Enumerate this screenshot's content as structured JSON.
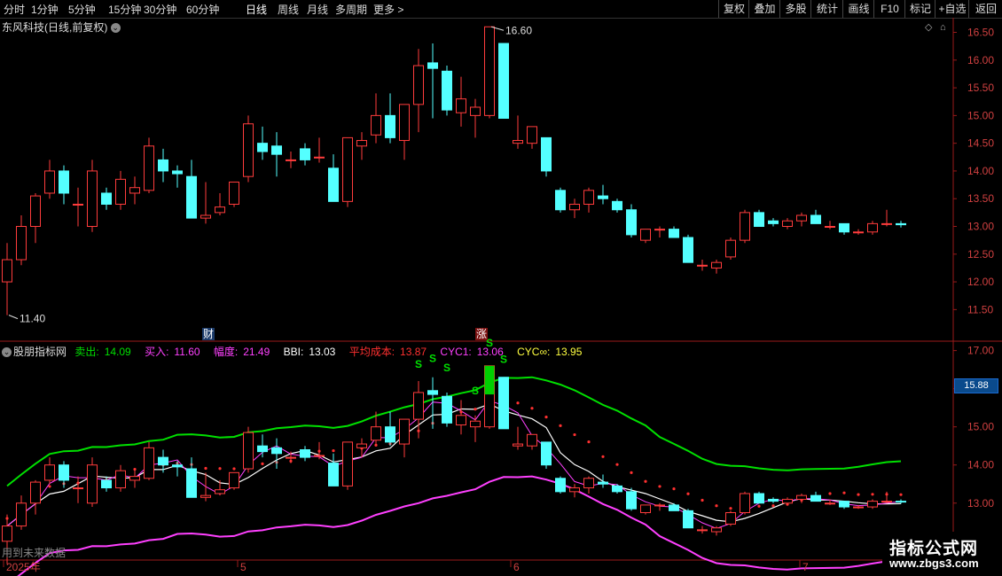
{
  "toolbar": {
    "periods": [
      "分时",
      "1分钟",
      "5分钟",
      "15分钟",
      "30分钟",
      "60分钟",
      "日线",
      "周线",
      "月线",
      "多周期",
      "更多 >"
    ],
    "active_period": "日线",
    "right_buttons": [
      "复权",
      "叠加",
      "多股",
      "统计",
      "画线",
      "F10",
      "标记",
      "+自选",
      "返回"
    ]
  },
  "stock": {
    "title": "东风科技(日线,前复权)",
    "high_label": "16.60",
    "low_label": "11.40",
    "badge_cai": "财",
    "badge_zhang": "涨"
  },
  "main_axis": {
    "ticks": [
      "16.50",
      "16.00",
      "15.50",
      "15.00",
      "14.50",
      "14.00",
      "13.50",
      "13.00",
      "12.50",
      "12.00",
      "11.50"
    ]
  },
  "indicator": {
    "name": "股朋指标网",
    "sell": {
      "label": "卖出:",
      "value": "14.09"
    },
    "buy": {
      "label": "买入:",
      "value": "11.60"
    },
    "range": {
      "label": "幅度:",
      "value": "21.49"
    },
    "bbi": {
      "label": "BBI:",
      "value": "13.03"
    },
    "avg_cost": {
      "label": "平均成本:",
      "value": "13.87"
    },
    "cyc1": {
      "label": "CYC1:",
      "value": "13.06"
    },
    "cycinf": {
      "label": "CYC∞:",
      "value": "13.95"
    },
    "current_price": "15.88",
    "signal_letter": "S",
    "future_note": "用到未来数据",
    "axis_ticks": [
      "17.00",
      "16.00",
      "15.00",
      "14.00",
      "13.00",
      "12.00"
    ]
  },
  "date_axis": {
    "labels": [
      "2025年",
      "5",
      "6",
      "7"
    ]
  },
  "watermark": {
    "title": "指标公式网",
    "url": "www.zbgs3.com"
  },
  "colors": {
    "up": "#ff3c3c",
    "down": "#54ffff",
    "sell": "#00e000",
    "buy": "#ff40ff",
    "bbi": "#ffffff",
    "avg_cost": "#ff3030",
    "cyc1": "#ff40ff",
    "cycinf": "#ffff40"
  },
  "chart_data": {
    "type": "candlestick",
    "series_name": "东风科技",
    "ohlc": [
      [
        12.0,
        12.7,
        11.4,
        12.4
      ],
      [
        12.4,
        13.2,
        12.3,
        13.0
      ],
      [
        13.0,
        13.6,
        12.7,
        13.55
      ],
      [
        13.6,
        14.2,
        13.5,
        14.0
      ],
      [
        14.0,
        14.1,
        13.4,
        13.6
      ],
      [
        13.4,
        13.7,
        13.0,
        13.4
      ],
      [
        13.0,
        14.2,
        12.9,
        14.0
      ],
      [
        13.6,
        13.7,
        13.3,
        13.4
      ],
      [
        13.4,
        14.0,
        13.3,
        13.85
      ],
      [
        13.6,
        13.9,
        13.4,
        13.7
      ],
      [
        13.65,
        14.6,
        13.6,
        14.45
      ],
      [
        14.2,
        14.4,
        13.8,
        14.0
      ],
      [
        14.0,
        14.1,
        13.7,
        13.95
      ],
      [
        13.9,
        14.2,
        13.15,
        13.15
      ],
      [
        13.15,
        13.8,
        13.05,
        13.2
      ],
      [
        13.25,
        13.6,
        13.2,
        13.35
      ],
      [
        13.4,
        13.8,
        13.35,
        13.8
      ],
      [
        13.9,
        15.0,
        13.8,
        14.85
      ],
      [
        14.5,
        14.8,
        14.2,
        14.35
      ],
      [
        14.45,
        14.7,
        13.9,
        14.3
      ],
      [
        14.2,
        14.35,
        14.05,
        14.2
      ],
      [
        14.4,
        14.5,
        14.1,
        14.2
      ],
      [
        14.25,
        14.6,
        14.15,
        14.25
      ],
      [
        14.05,
        14.3,
        13.45,
        13.45
      ],
      [
        13.45,
        14.6,
        13.35,
        14.6
      ],
      [
        14.45,
        14.7,
        14.2,
        14.55
      ],
      [
        14.65,
        15.4,
        14.5,
        15.0
      ],
      [
        15.0,
        15.4,
        14.5,
        14.6
      ],
      [
        14.55,
        15.2,
        14.2,
        15.2
      ],
      [
        15.2,
        16.2,
        14.7,
        15.9
      ],
      [
        15.95,
        16.3,
        14.95,
        15.85
      ],
      [
        15.8,
        15.9,
        15.0,
        15.1
      ],
      [
        15.05,
        15.7,
        14.8,
        15.3
      ],
      [
        15.0,
        15.3,
        14.6,
        15.15
      ],
      [
        15.0,
        16.6,
        14.95,
        16.6
      ],
      [
        16.3,
        16.3,
        14.95,
        14.95
      ],
      [
        14.5,
        15.0,
        14.4,
        14.55
      ],
      [
        14.5,
        14.8,
        14.4,
        14.8
      ],
      [
        14.6,
        14.6,
        13.9,
        14.0
      ],
      [
        13.65,
        13.7,
        13.25,
        13.3
      ],
      [
        13.3,
        13.5,
        13.15,
        13.4
      ],
      [
        13.4,
        13.7,
        13.25,
        13.65
      ],
      [
        13.55,
        13.75,
        13.4,
        13.5
      ],
      [
        13.45,
        13.5,
        13.25,
        13.3
      ],
      [
        13.3,
        13.4,
        12.8,
        12.85
      ],
      [
        12.75,
        12.95,
        12.7,
        12.95
      ],
      [
        12.95,
        13.0,
        12.8,
        12.95
      ],
      [
        12.95,
        13.0,
        12.8,
        12.8
      ],
      [
        12.8,
        12.85,
        12.35,
        12.35
      ],
      [
        12.3,
        12.4,
        12.2,
        12.3
      ],
      [
        12.25,
        12.4,
        12.15,
        12.35
      ],
      [
        12.45,
        12.8,
        12.4,
        12.75
      ],
      [
        12.75,
        13.3,
        12.7,
        13.25
      ],
      [
        13.25,
        13.3,
        13.0,
        13.0
      ],
      [
        13.1,
        13.15,
        13.0,
        13.05
      ],
      [
        13.0,
        13.15,
        12.95,
        13.1
      ],
      [
        13.1,
        13.25,
        13.0,
        13.2
      ],
      [
        13.2,
        13.3,
        13.05,
        13.05
      ],
      [
        13.0,
        13.1,
        12.95,
        13.0
      ],
      [
        13.05,
        13.05,
        12.85,
        12.9
      ],
      [
        12.9,
        12.95,
        12.85,
        12.9
      ],
      [
        12.9,
        13.1,
        12.85,
        13.05
      ],
      [
        13.05,
        13.3,
        13.0,
        13.05
      ],
      [
        13.05,
        13.1,
        12.98,
        13.03
      ]
    ],
    "sell_line": [
      14.09
    ],
    "buy_line": [
      11.6
    ],
    "y_range_main": [
      11.25,
      16.7
    ],
    "y_range_indicator": [
      11.6,
      17.2
    ],
    "x_labels": [
      "2025年",
      "5",
      "6",
      "7"
    ]
  }
}
